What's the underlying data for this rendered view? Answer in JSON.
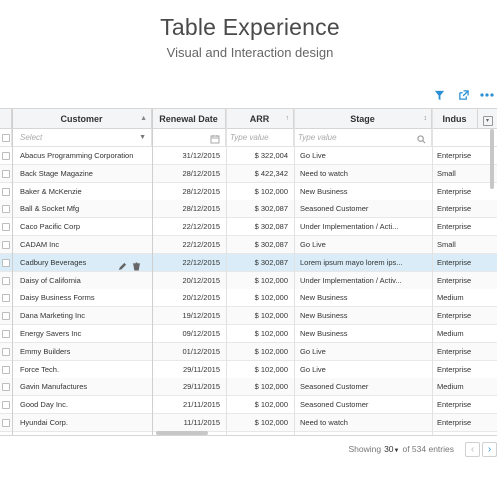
{
  "hero": {
    "title": "Table Experience",
    "subtitle": "Visual and Interaction design"
  },
  "toolbar": {
    "icons": [
      "filter-icon",
      "export-icon",
      "more-icon"
    ]
  },
  "columns": {
    "customer": "Customer",
    "renewal": "Renewal Date",
    "arr": "ARR",
    "stage": "Stage",
    "industry": "Indus"
  },
  "filters": {
    "customer_placeholder": "Select",
    "arr_placeholder": "Type value",
    "stage_placeholder": "Type value"
  },
  "rows": [
    {
      "customer": "Abacus Programming Corporation",
      "date": "31/12/2015",
      "arr": "$ 322,004",
      "stage": "Go Live",
      "industry": "Enterprise"
    },
    {
      "customer": "Back Stage Magazine",
      "date": "28/12/2015",
      "arr": "$ 422,342",
      "stage": "Need to watch",
      "industry": "Small"
    },
    {
      "customer": "Baker & McKenzie",
      "date": "28/12/2015",
      "arr": "$ 102,000",
      "stage": "New Business",
      "industry": "Enterprise"
    },
    {
      "customer": "Ball & Socket Mfg",
      "date": "28/12/2015",
      "arr": "$ 302,087",
      "stage": "Seasoned Customer",
      "industry": "Enterprise"
    },
    {
      "customer": "Caco Pacific Corp",
      "date": "22/12/2015",
      "arr": "$ 302,087",
      "stage": "Under Implementation / Acti...",
      "industry": "Enterprise"
    },
    {
      "customer": "CADAM Inc",
      "date": "22/12/2015",
      "arr": "$ 302,087",
      "stage": "Go Live",
      "industry": "Small"
    },
    {
      "customer": "Cadbury Beverages",
      "date": "22/12/2015",
      "arr": "$ 302,087",
      "stage": "Lorem ipsum mayo lorem ips...",
      "industry": "Enterprise"
    },
    {
      "customer": "Daisy of California",
      "date": "20/12/2015",
      "arr": "$ 102,000",
      "stage": "Under Implementation / Activ...",
      "industry": "Enterprise"
    },
    {
      "customer": "Daisy Business Forms",
      "date": "20/12/2015",
      "arr": "$ 102,000",
      "stage": "New Business",
      "industry": "Medium"
    },
    {
      "customer": "Dana Marketing Inc",
      "date": "19/12/2015",
      "arr": "$ 102,000",
      "stage": "New Business",
      "industry": "Enterprise"
    },
    {
      "customer": "Energy Savers Inc",
      "date": "09/12/2015",
      "arr": "$ 102,000",
      "stage": "New Business",
      "industry": "Medium"
    },
    {
      "customer": "Emmy Builders",
      "date": "01/12/2015",
      "arr": "$ 102,000",
      "stage": "Go Live",
      "industry": "Enterprise"
    },
    {
      "customer": "Force Tech.",
      "date": "29/11/2015",
      "arr": "$ 102,000",
      "stage": "Go Live",
      "industry": "Enterprise"
    },
    {
      "customer": "Gavin Manufactures",
      "date": "29/11/2015",
      "arr": "$ 102,000",
      "stage": "Seasoned Customer",
      "industry": "Medium"
    },
    {
      "customer": "Good Day Inc.",
      "date": "21/11/2015",
      "arr": "$ 102,000",
      "stage": "Seasoned Customer",
      "industry": "Enterprise"
    },
    {
      "customer": "Hyundai Corp.",
      "date": "11/11/2015",
      "arr": "$ 102,000",
      "stage": "Need to watch",
      "industry": "Enterprise"
    }
  ],
  "footer": {
    "showing_label": "Showing",
    "page_size": "30",
    "of_label": "of 534 entries"
  },
  "colors": {
    "accent": "#2b8fd6",
    "selected_row": "#d9ecf8",
    "header_bg": "#f4f5f7"
  }
}
